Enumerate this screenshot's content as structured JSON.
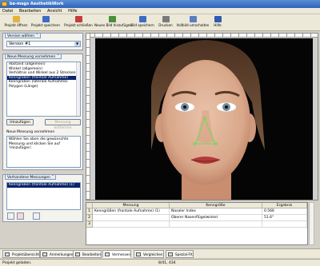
{
  "window": {
    "title": "be-mags AesthetikWork"
  },
  "menu": [
    "Datei",
    "Bearbeiten",
    "Ansicht",
    "Hilfe"
  ],
  "toolbar": [
    {
      "label": "Projekt öffnen",
      "icon": "folder-open-icon",
      "color": "#e4b33a"
    },
    {
      "label": "Projekt speichern",
      "icon": "save-icon",
      "color": "#3d6cc4"
    },
    {
      "label": "Projekt schließen",
      "icon": "close-icon",
      "color": "#c43c3c"
    },
    {
      "label": "Neues Bild hinzufügen",
      "icon": "add-image-icon",
      "color": "#4a8f3a"
    },
    {
      "label": "Bild speichern",
      "icon": "save-image-icon",
      "color": "#3d6cc4"
    },
    {
      "label": "Drucken",
      "icon": "print-icon",
      "color": "#7a7a7a"
    },
    {
      "label": "Vollbild umschalten",
      "icon": "fullscreen-icon",
      "color": "#5a7fbf"
    },
    {
      "label": "Hilfe",
      "icon": "help-icon",
      "color": "#2f5bb0"
    }
  ],
  "version_group": {
    "title": "Version wählen",
    "selected": "Version #1"
  },
  "measure_group": {
    "title": "Neue Messung vornehmen",
    "list": [
      "Abstand (allgemein)",
      "Winkel (allgemein)",
      "Verhältnis und Winkel aus 2 Strecken",
      "Kenngrößen (frontale Aufnahme)",
      "Kenngrößen (laterale Aufnahme)",
      "Polygon (Länge)"
    ],
    "selected_index": 3,
    "add_button": "Hinzufügen",
    "remove_button": "Messung entfernen",
    "help_title": "Neue Messung vornehmen",
    "help_text": "Wählen Sie oben die gewünschte Messung und klicken Sie auf 'Hinzufügen'."
  },
  "existing_group": {
    "title": "Vorhandene Messungen",
    "list": [
      "Kenngrößen (frontale Aufnahme) (1)"
    ],
    "selected_index": 0,
    "icons": [
      "edit-icon",
      "delete-icon",
      "copy-icon"
    ]
  },
  "table": {
    "headers": [
      "Messung",
      "Kenngröße",
      "Ergebnis"
    ],
    "rows": [
      {
        "num": "1",
        "messung": "Kenngrößen (frontale Aufnahme) (1)",
        "kenngroesse": "Nasaler Index",
        "ergebnis": "0.566"
      },
      {
        "num": "2",
        "messung": "",
        "kenngroesse": "Oberer Nasenflügelwinkel",
        "ergebnis": "51.6°"
      },
      {
        "num": "3",
        "messung": "",
        "kenngroesse": "",
        "ergebnis": ""
      }
    ]
  },
  "tabs": [
    {
      "label": "Projektübersicht",
      "active": false
    },
    {
      "label": "Anmerkungen",
      "active": false
    },
    {
      "label": "Bearbeiten",
      "active": false
    },
    {
      "label": "Vermessen",
      "active": true
    },
    {
      "label": "Vergleichen",
      "active": false
    },
    {
      "label": "Spezial-FX",
      "active": false
    }
  ],
  "status": {
    "left": "Projekt geladen.",
    "coords": "8/41, 434"
  },
  "colors": {
    "measure_line": "#7fd35f",
    "selection": "#0a246a"
  }
}
